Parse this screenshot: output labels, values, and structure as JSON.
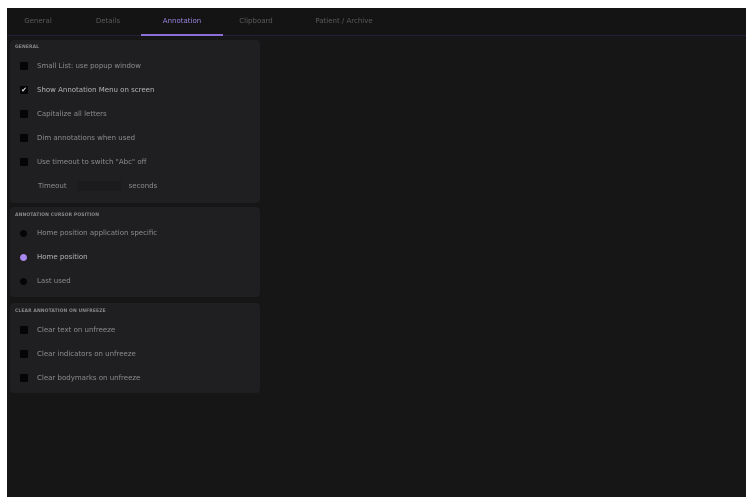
{
  "tabs": [
    {
      "label": "General",
      "active": false
    },
    {
      "label": "Details",
      "active": false
    },
    {
      "label": "Annotation",
      "active": true
    },
    {
      "label": "Clipboard",
      "active": false
    },
    {
      "label": "Patient / Archive",
      "active": false
    }
  ],
  "general": {
    "title": "GENERAL",
    "options": [
      {
        "label": "Small List: use popup window",
        "checked": false
      },
      {
        "label": "Show Annotation Menu on screen",
        "checked": true
      },
      {
        "label": "Capitalize all letters",
        "checked": false
      },
      {
        "label": "Dim annotations when used",
        "checked": false
      },
      {
        "label": "Use timeout to switch \"Abc\" off",
        "checked": false
      }
    ],
    "timeout": {
      "label": "Timeout",
      "value": "",
      "unit": "seconds"
    }
  },
  "cursor_position": {
    "title": "ANNOTATION CURSOR POSITION",
    "options": [
      {
        "label": "Home position application specific",
        "selected": false
      },
      {
        "label": "Home position",
        "selected": true
      },
      {
        "label": "Last used",
        "selected": false
      }
    ]
  },
  "clear_on_unfreeze": {
    "title": "CLEAR ANNOTATION ON UNFREEZE",
    "options": [
      {
        "label": "Clear text on unfreeze",
        "checked": false
      },
      {
        "label": "Clear indicators on unfreeze",
        "checked": false
      },
      {
        "label": "Clear bodymarks on unfreeze",
        "checked": false
      }
    ]
  },
  "colors": {
    "accent": "#8b6fd6",
    "background": "#161616",
    "panel": "#1f1e21"
  }
}
